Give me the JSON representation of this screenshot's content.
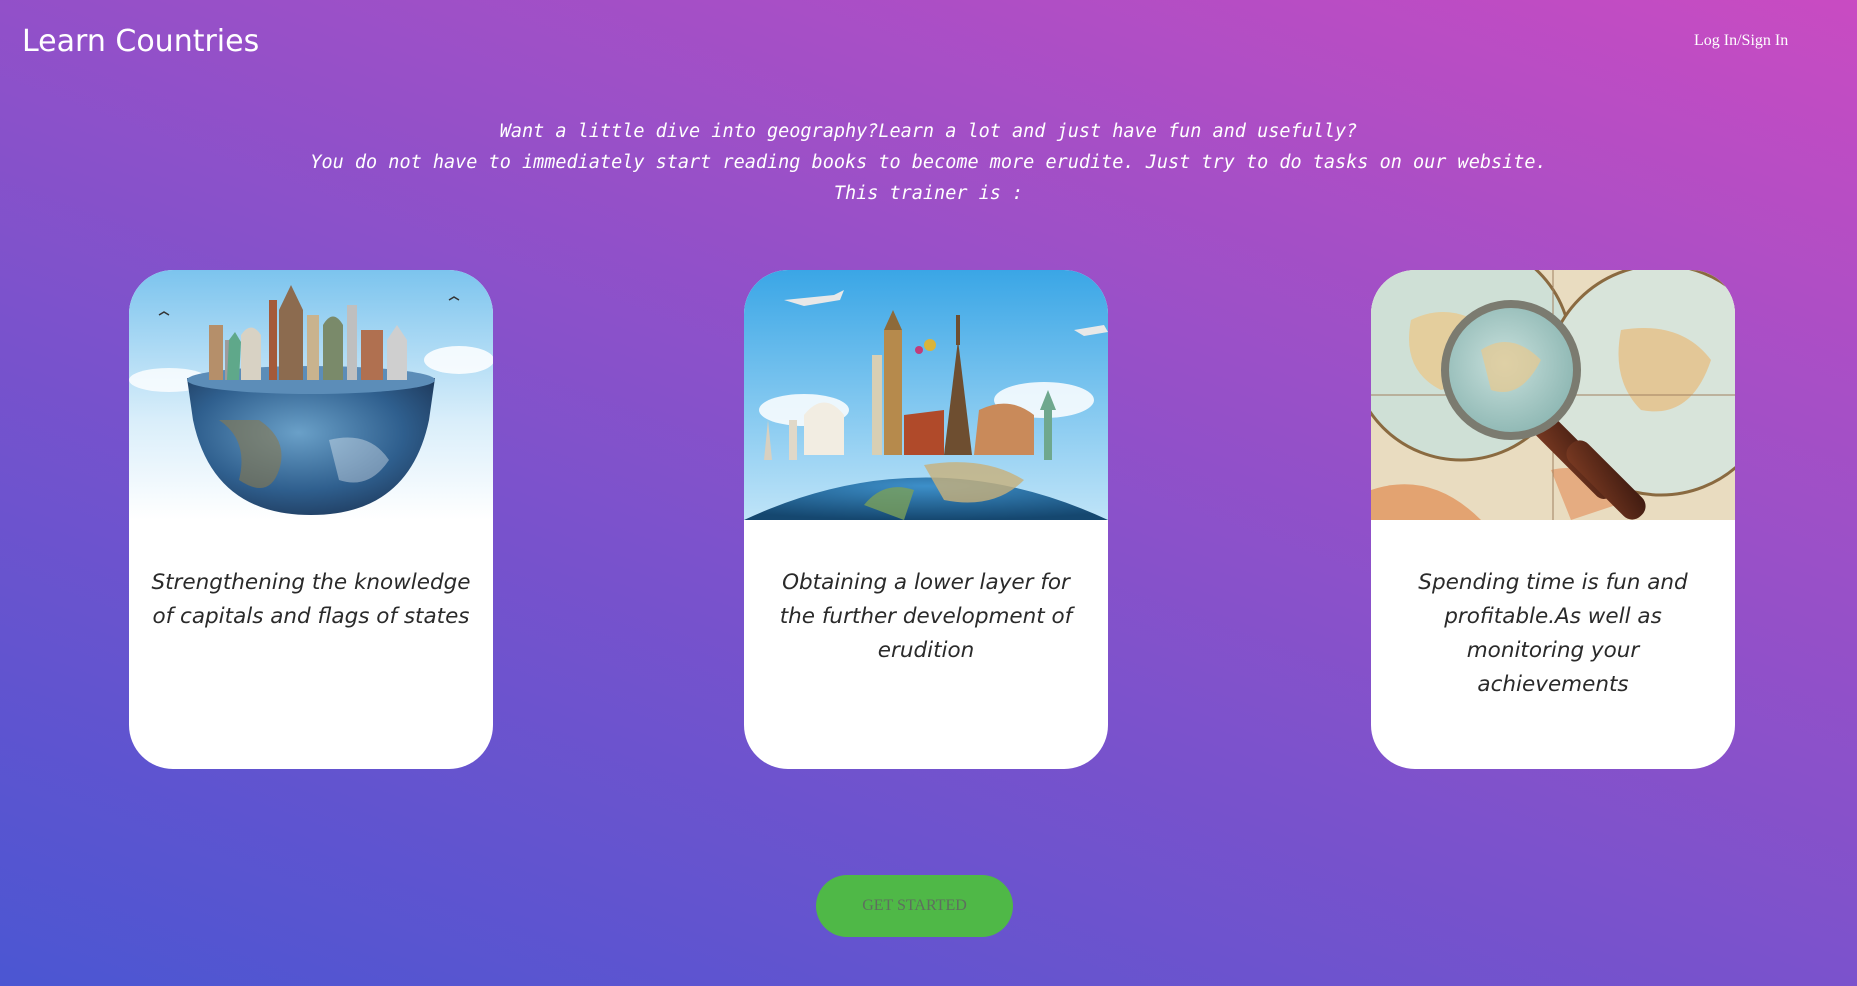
{
  "header": {
    "brand": "Learn Countries",
    "login_label": "Log In/Sign In"
  },
  "intro": {
    "line1": "Want a little dive into geography?Learn a lot and just have fun and usefully?",
    "line2": "You do not have to immediately start reading books to become more erudite. Just try to do tasks on our website.",
    "line3": "This trainer is :"
  },
  "cards": [
    {
      "image": "globe-bowl-landmarks-image",
      "text": "Strengthening the knowledge of capitals and flags of states"
    },
    {
      "image": "world-landmarks-image",
      "text": "Obtaining a lower layer for the further development of erudition"
    },
    {
      "image": "antique-map-magnifier-image",
      "text": "Spending time is fun and profitable.As well as monitoring your achievements"
    }
  ],
  "cta": {
    "label": "GET STARTED"
  },
  "colors": {
    "background_start": "#4b56d2",
    "background_end": "#c94bc2",
    "cta_background": "#4fb847",
    "card_background": "#ffffff"
  }
}
